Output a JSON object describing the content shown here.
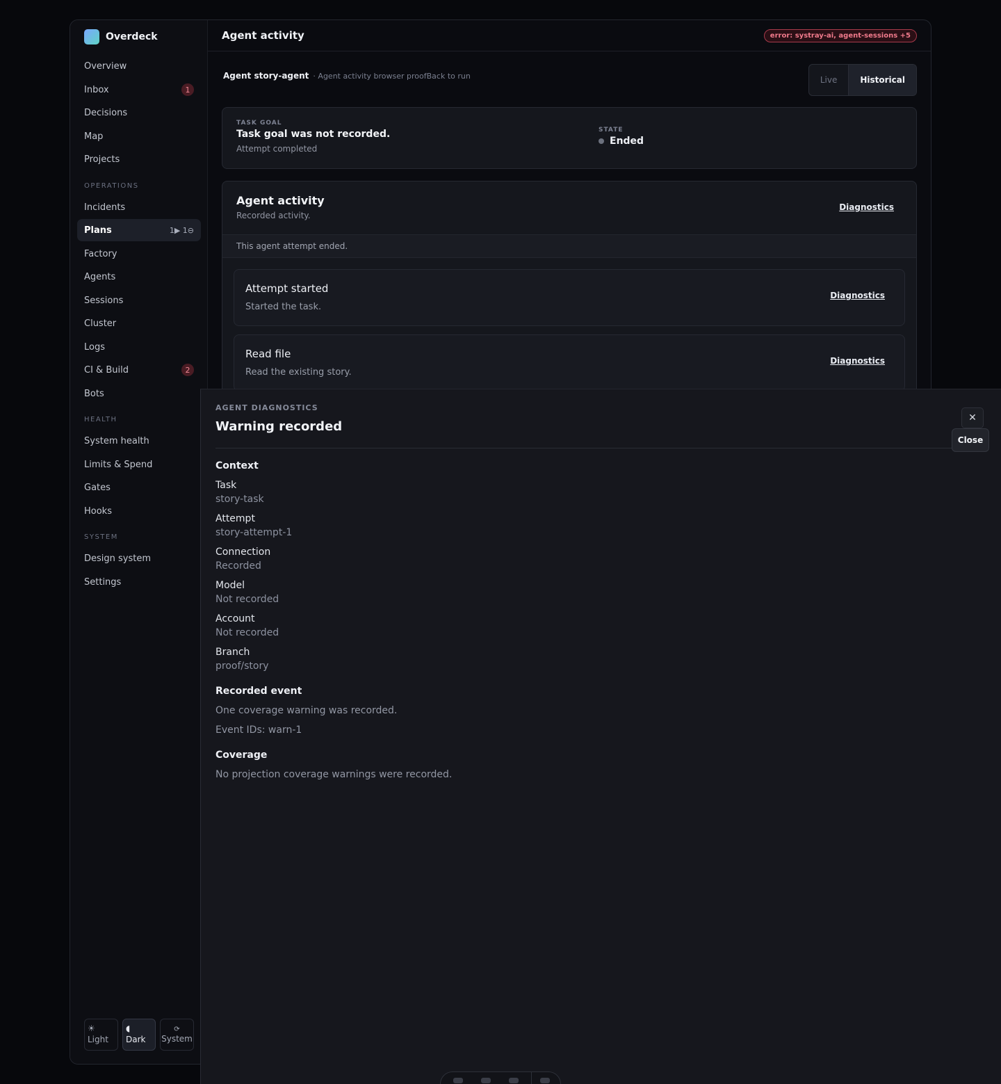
{
  "brand": {
    "name": "Overdeck"
  },
  "sidebar": {
    "main_items": [
      {
        "label": "Overview"
      },
      {
        "label": "Inbox",
        "badge": "1"
      },
      {
        "label": "Decisions"
      },
      {
        "label": "Map"
      },
      {
        "label": "Projects"
      }
    ],
    "sections": [
      {
        "title": "OPERATIONS",
        "items": [
          {
            "label": "Incidents"
          },
          {
            "label": "Plans",
            "badge": "1▶ 1⊖",
            "active": true
          },
          {
            "label": "Factory"
          },
          {
            "label": "Agents"
          },
          {
            "label": "Sessions"
          },
          {
            "label": "Cluster"
          },
          {
            "label": "Logs"
          },
          {
            "label": "CI & Build",
            "badge": "2"
          },
          {
            "label": "Bots"
          }
        ]
      },
      {
        "title": "HEALTH",
        "items": [
          {
            "label": "System health"
          },
          {
            "label": "Limits & Spend"
          },
          {
            "label": "Gates"
          },
          {
            "label": "Hooks"
          }
        ]
      },
      {
        "title": "SYSTEM",
        "items": [
          {
            "label": "Design system"
          },
          {
            "label": "Settings"
          }
        ]
      }
    ],
    "theme": {
      "light": "☀ Light",
      "dark": "◖ Dark",
      "system_icon": "⟳",
      "system": "System",
      "selected": "Dark"
    }
  },
  "header": {
    "title": "Agent activity",
    "error": "error: systray-ai, agent-sessions +5"
  },
  "breadcrumb": {
    "agent": "Agent story-agent",
    "subtitle": "· Agent activity browser proof",
    "back": "Back to run"
  },
  "mode": {
    "live": "Live",
    "historical": "Historical",
    "selected": "Historical"
  },
  "goal_card": {
    "kicker": "TASK GOAL",
    "title": "Task goal was not recorded.",
    "subtitle": "Attempt completed",
    "state_label": "STATE",
    "state_value": "Ended"
  },
  "activity": {
    "title": "Agent activity",
    "subtitle": "Recorded activity.",
    "diagnostics": "Diagnostics",
    "banner": "This agent attempt ended.",
    "events": [
      {
        "title": "Attempt started",
        "subtitle": "Started the task.",
        "diagnostics": "Diagnostics"
      },
      {
        "title": "Read file",
        "subtitle": "Read the existing story.",
        "diagnostics": "Diagnostics"
      }
    ]
  },
  "drawer": {
    "kicker": "AGENT DIAGNOSTICS",
    "title": "Warning recorded",
    "close_icon": "✕",
    "close_tooltip": "Close",
    "context_title": "Context",
    "context": [
      {
        "key": "Task",
        "value": "story-task"
      },
      {
        "key": "Attempt",
        "value": "story-attempt-1"
      },
      {
        "key": "Connection",
        "value": "Recorded"
      },
      {
        "key": "Model",
        "value": "Not recorded"
      },
      {
        "key": "Account",
        "value": "Not recorded"
      },
      {
        "key": "Branch",
        "value": "proof/story"
      }
    ],
    "recorded_title": "Recorded event",
    "recorded_text": "One coverage warning was recorded.",
    "event_ids": "Event IDs: warn-1",
    "coverage_title": "Coverage",
    "coverage_text": "No projection coverage warnings were recorded."
  }
}
